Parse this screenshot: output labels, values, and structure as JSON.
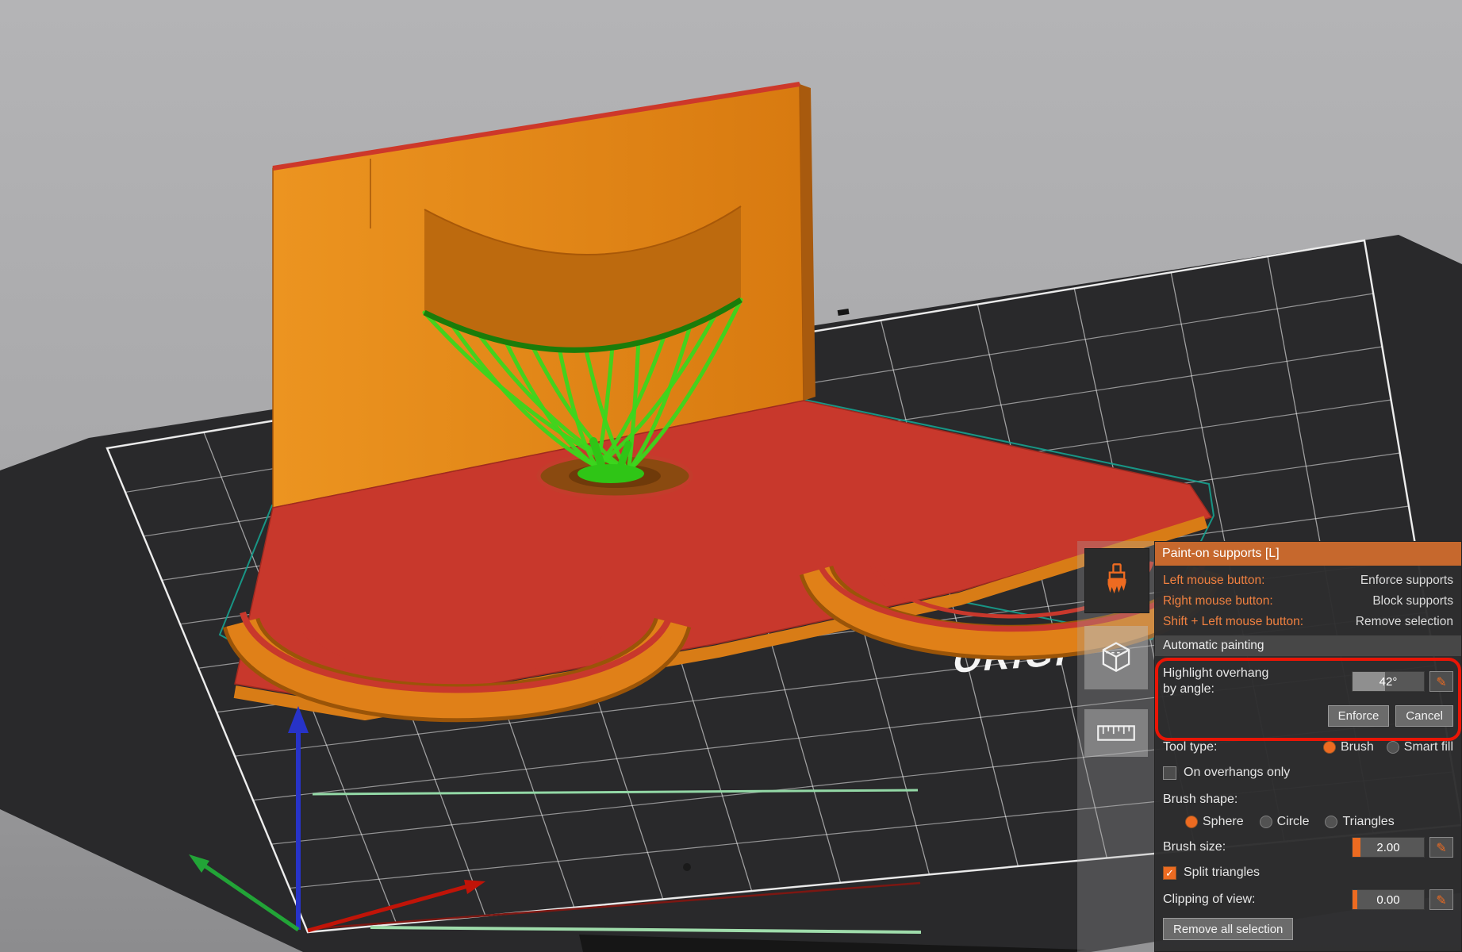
{
  "accent_color": "#ED6B21",
  "annotation_color": "#ea1506",
  "model_colors": {
    "body_orange": "#e08018",
    "overhang_red": "#c8382c",
    "support_green": "#3bd61d",
    "selection_teal": "#16a18f"
  },
  "viewport": {
    "bed_text": "ORIGI"
  },
  "gizmo_toolbar": {
    "tools": [
      {
        "icon": "brush-icon",
        "active": true
      },
      {
        "icon": "cube-icon",
        "active": false
      },
      {
        "icon": "ruler-icon",
        "active": false
      }
    ]
  },
  "icons": {
    "pencil": "✎",
    "check": "✓"
  },
  "panel": {
    "title": "Paint-on supports [L]",
    "mouse_hints": [
      {
        "label": "Left mouse button:",
        "value": "Enforce supports"
      },
      {
        "label": "Right mouse button:",
        "value": "Block supports"
      },
      {
        "label": "Shift + Left mouse button:",
        "value": "Remove selection"
      }
    ],
    "automatic_painting": "Automatic painting",
    "highlight_overhang": {
      "label_line1": "Highlight overhang",
      "label_line2": "by angle:",
      "value": "42°"
    },
    "enforce_button": "Enforce",
    "cancel_button": "Cancel",
    "tool_type": {
      "label": "Tool type:",
      "options": [
        {
          "label": "Brush",
          "selected": true
        },
        {
          "label": "Smart fill",
          "selected": false
        }
      ]
    },
    "on_overhangs_only": {
      "label": "On overhangs only",
      "checked": false
    },
    "brush_shape": {
      "label": "Brush shape:",
      "options": [
        {
          "label": "Sphere",
          "selected": true
        },
        {
          "label": "Circle",
          "selected": false
        },
        {
          "label": "Triangles",
          "selected": false
        }
      ]
    },
    "brush_size": {
      "label": "Brush size:",
      "value": "2.00"
    },
    "split_triangles": {
      "label": "Split triangles",
      "checked": true
    },
    "clipping_of_view": {
      "label": "Clipping of view:",
      "value": "0.00"
    },
    "remove_all_button": "Remove all selection"
  }
}
